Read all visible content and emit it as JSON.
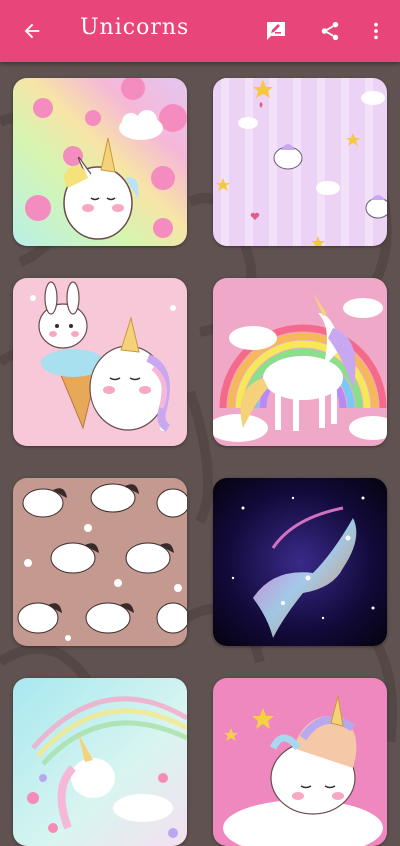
{
  "appbar": {
    "title": "Unicorns",
    "back_icon": "arrow-back-icon",
    "edit_icon": "rate-review-icon",
    "share_icon": "share-icon",
    "more_icon": "more-vert-icon",
    "color": "#e8457a"
  },
  "wallpapers": [
    {
      "name": "rainbow-bubbles-unicorn"
    },
    {
      "name": "pastel-stripes-unicorn-pattern"
    },
    {
      "name": "ice-cream-unicorn"
    },
    {
      "name": "rainbow-white-unicorn"
    },
    {
      "name": "mauve-unicorn-pattern"
    },
    {
      "name": "galaxy-glitter-unicorn"
    },
    {
      "name": "flower-rainbow-unicorn"
    },
    {
      "name": "sleeping-unicorn-cloud"
    }
  ]
}
